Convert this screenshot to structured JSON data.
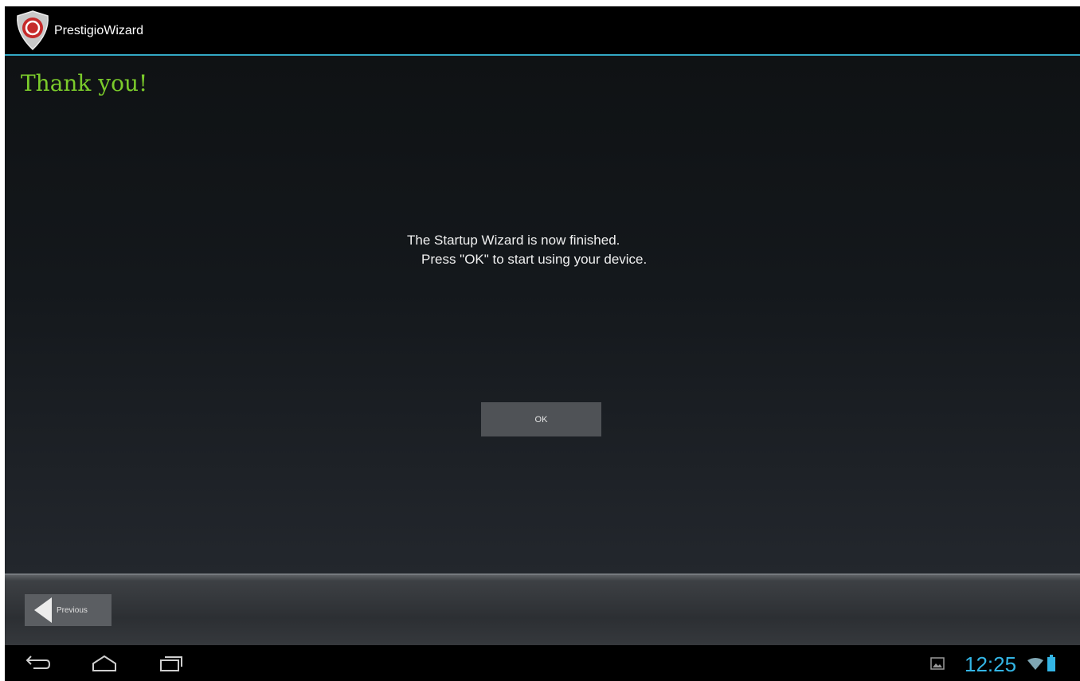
{
  "app": {
    "title": "PrestigioWizard"
  },
  "page": {
    "heading": "Thank you!",
    "message_line1": "The Startup Wizard is now finished.",
    "message_line2": "Press \"OK\" to start using your device."
  },
  "buttons": {
    "ok": "OK",
    "previous": "Previous"
  },
  "navbar": {
    "icons": [
      "back-icon",
      "home-icon",
      "recent-apps-icon"
    ]
  },
  "status": {
    "time": "12:25",
    "icons": [
      "gallery-notification-icon",
      "wifi-icon",
      "battery-icon"
    ]
  },
  "colors": {
    "accent": "#33a8c4",
    "heading": "#7bcb2b",
    "clock": "#33b5e5"
  }
}
